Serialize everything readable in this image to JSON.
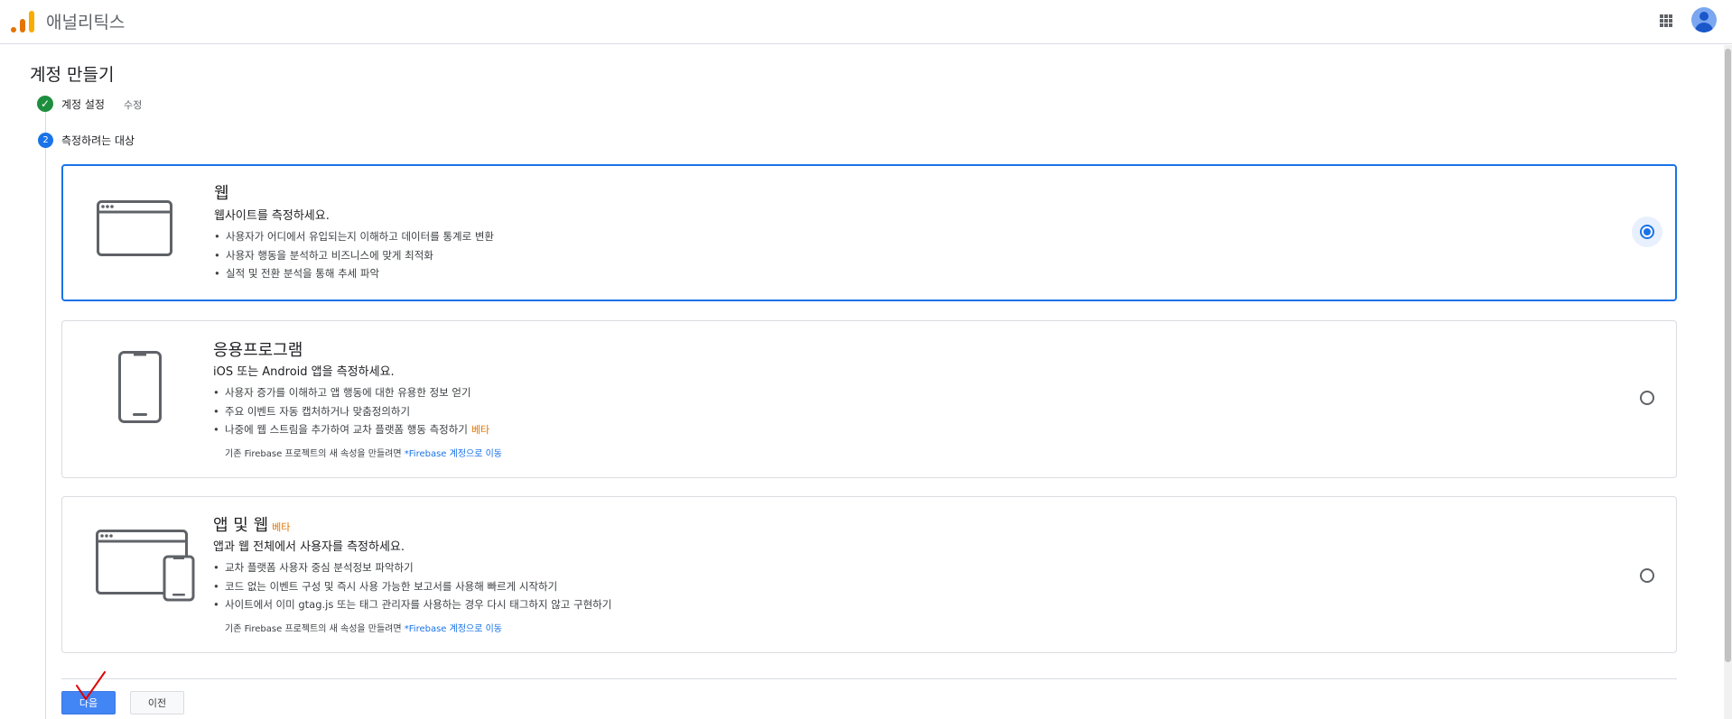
{
  "header": {
    "app_title": "애널리틱스",
    "logo_icon": "analytics-logo",
    "apps_icon": "apps-grid-icon",
    "avatar_icon": "account-avatar"
  },
  "page": {
    "title": "계정 만들기"
  },
  "stepper": {
    "step1": {
      "label": "계정 설정",
      "edit_label": "수정",
      "status": "complete"
    },
    "step2": {
      "number": "2",
      "label": "측정하려는 대상",
      "status": "current"
    }
  },
  "options": {
    "web": {
      "title": "웹",
      "subtitle": "웹사이트를 측정하세요.",
      "bullets": [
        "사용자가 어디에서 유입되는지 이해하고 데이터를 통계로 변환",
        "사용자 행동을 분석하고 비즈니스에 맞게 최적화",
        "실적 및 전환 분석을 통해 추세 파악"
      ],
      "selected": true
    },
    "app": {
      "title": "응용프로그램",
      "subtitle": "iOS 또는 Android 앱을 측정하세요.",
      "bullets": [
        "사용자 증가를 이해하고 앱 행동에 대한 유용한 정보 얻기",
        "주요 이벤트 자동 캡처하거나 맞춤정의하기",
        "나중에 웹 스트림을 추가하여 교차 플랫폼 행동 측정하기"
      ],
      "bullet3_badge": "베타",
      "note_prefix": "기존 Firebase 프로젝트의 새 속성을 만들려면",
      "note_link": "Firebase 계정으로 이동",
      "selected": false
    },
    "both": {
      "title": "앱 및 웹",
      "badge": "베타",
      "subtitle": "앱과 웹 전체에서 사용자를 측정하세요.",
      "bullets": [
        "교차 플랫폼 사용자 중심 분석정보 파악하기",
        "코드 없는 이벤트 구성 및 즉시 사용 가능한 보고서를 사용해 빠르게 시작하기",
        "사이트에서 이미 gtag.js 또는 태그 관리자를 사용하는 경우 다시 태그하지 않고 구현하기"
      ],
      "note_prefix": "기존 Firebase 프로젝트의 새 속성을 만들려면",
      "note_link": "Firebase 계정으로 이동",
      "selected": false
    }
  },
  "buttons": {
    "next": "다음",
    "previous": "이전"
  },
  "colors": {
    "accent": "#1a73e8",
    "primary_button": "#4285f4",
    "success": "#1e8e3e",
    "beta": "#e37400",
    "annotation_mark": "#e00000"
  }
}
